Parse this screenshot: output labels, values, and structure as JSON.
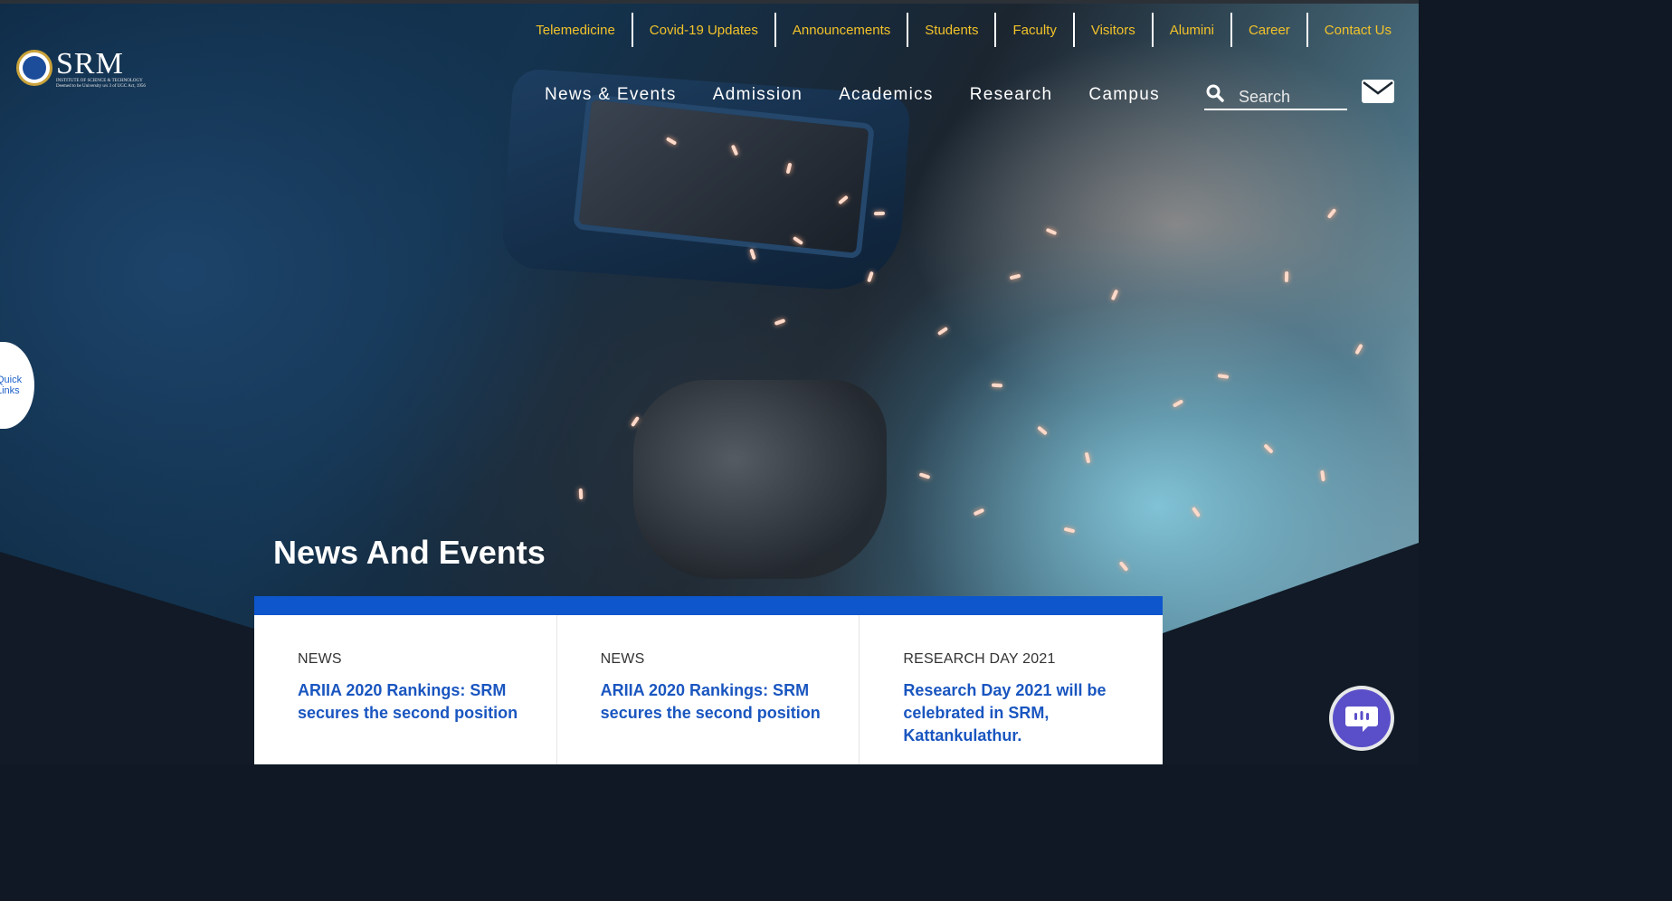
{
  "brand": {
    "name": "SRM",
    "subtitle_line1": "INSTITUTE OF SCIENCE & TECHNOLOGY",
    "subtitle_line2": "Deemed to be University u/s 3 of UGC Act, 1956"
  },
  "utility_nav": [
    "Telemedicine",
    "Covid-19 Updates",
    "Announcements",
    "Students",
    "Faculty",
    "Visitors",
    "Alumini",
    "Career",
    "Contact Us"
  ],
  "main_nav": [
    "News & Events",
    "Admission",
    "Academics",
    "Research",
    "Campus"
  ],
  "search": {
    "placeholder": "Search"
  },
  "quick_links": {
    "line1": "Quick",
    "line2": "Links"
  },
  "section_title": "News And Events",
  "news": [
    {
      "category": "NEWS",
      "title": "ARIIA 2020 Rankings: SRM secures the second position"
    },
    {
      "category": "NEWS",
      "title": "ARIIA 2020 Rankings: SRM secures the second position"
    },
    {
      "category": "RESEARCH DAY 2021",
      "title": "Research Day 2021 will be celebrated in SRM, Kattankulathur."
    }
  ],
  "colors": {
    "utility_link": "#f2c22a",
    "accent_blue": "#0d56cc",
    "news_link": "#1a56c0",
    "chat": "#5a4fc8"
  },
  "icons": [
    "search-icon",
    "mail-icon",
    "chat-icon"
  ]
}
